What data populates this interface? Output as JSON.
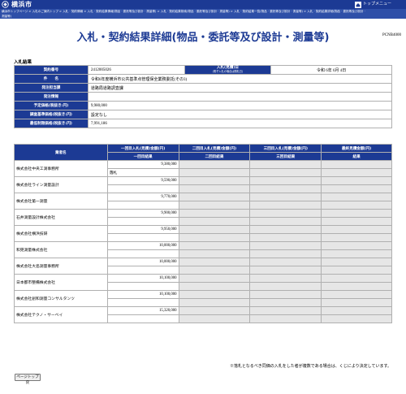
{
  "header": {
    "site_name": "横浜市",
    "top_menu_label": "トップメニュー",
    "top_menu_icon": "home-icon",
    "logo_icon": "city-emblem-icon"
  },
  "breadcrumb": {
    "line1": "横浜市トップページ > 入札のご案内トップ > 入札 · 契約情報 > 入札 · 契約結果情報(物品 · 委託等及び設計 · 測量等) > 入札 · 契約結果検索(物品 · 委託等及び設計 · 測量等) > 入札 · 契約結果一覧(物品 · 委託等及び設計 · 測量等) > 入札 · 契約結果詳細(物品 · 委託等及び設計 ·",
    "line2": "測量等)"
  },
  "title": "入札・契約結果詳細(物品・委託等及び設計・測量等)",
  "page_code": "PCNB4000",
  "section_label": "入札結果",
  "info": {
    "contract_no_label": "契約番号",
    "contract_no": "2412005026",
    "bid_date_label": "入札(見積)日",
    "bid_date_sub": "(電子入札の場合は開札日)",
    "bid_date": "令和 6年 6月 4日",
    "subject_label": "件　　名",
    "subject": "令和6年度横浜市公共基準点管理保全業務委託(その3)",
    "dept_label": "発注担当課",
    "dept": "道路局道路調査課",
    "info_label": "発注情報",
    "planned_price_label": "予定価格(税抜き:円)",
    "planned_price": "9,980,000",
    "survey_price_label": "調査基準価格(税抜き:円)",
    "survey_price": "設定なし",
    "min_price_label": "最低制限価格(税抜き:円)",
    "min_price": "7,991,186"
  },
  "bids_table": {
    "col_company": "業者名",
    "col_round1": "一回目入札(見積)金額(円)",
    "col_round2": "二回目入札(見積)金額(円)",
    "col_round3": "三回目入札(見積)金額(円)",
    "col_final": "最終見積金額(円)",
    "sub_round1": "一回目結果",
    "sub_round2": "二回目結果",
    "sub_round3": "三回目結果",
    "sub_final": "結果",
    "rows": [
      {
        "company": "株式会社中央工測事務所",
        "amount1": "9,380,000",
        "result1": "落札"
      },
      {
        "company": "株式会社ライン測量設計",
        "amount1": "9,590,000",
        "result1": ""
      },
      {
        "company": "株式会社第一測量",
        "amount1": "9,770,000",
        "result1": ""
      },
      {
        "company": "石井測量設計株式会社",
        "amount1": "9,900,000",
        "result1": ""
      },
      {
        "company": "株式会社横浜技研",
        "amount1": "9,950,000",
        "result1": ""
      },
      {
        "company": "和晃測量株式会社",
        "amount1": "10,000,000",
        "result1": ""
      },
      {
        "company": "株式会社大島測量事務所",
        "amount1": "10,000,000",
        "result1": ""
      },
      {
        "company": "日本都市整備株式会社",
        "amount1": "10,100,000",
        "result1": ""
      },
      {
        "company": "株式会社創和測量コンサルタンツ",
        "amount1": "10,100,000",
        "result1": ""
      },
      {
        "company": "株式会社テクノ・サーベイ",
        "amount1": "15,320,000",
        "result1": ""
      }
    ]
  },
  "note": "※落札となるべき同価の入札をした者が複数である場合は、くじにより決定しています。",
  "back_button_label": "ページトップ戻"
}
